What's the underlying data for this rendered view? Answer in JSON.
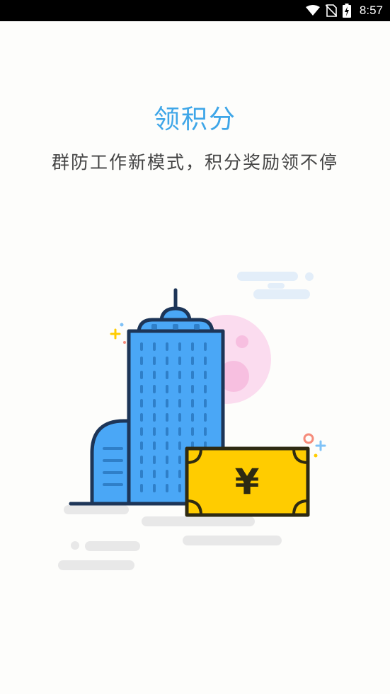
{
  "status_bar": {
    "time": "8:57",
    "icons": [
      "wifi-icon",
      "no-sim-icon",
      "battery-charging-icon"
    ]
  },
  "onboarding": {
    "title": "领积分",
    "subtitle": "群防工作新模式，积分奖励领不停",
    "illustration": {
      "currency_symbol": "¥",
      "icons": [
        "building-icon",
        "banknote-icon",
        "moon-icon",
        "cloud-icon",
        "sparkle-icon"
      ]
    }
  },
  "colors": {
    "accent": "#3ea6e8",
    "status_bar": "#000000",
    "background": "#fdfdfb",
    "building": "#4aa7f6",
    "banknote": "#ffcc00",
    "moon": "#fbdcef",
    "cloud": "#e8e8e8"
  }
}
